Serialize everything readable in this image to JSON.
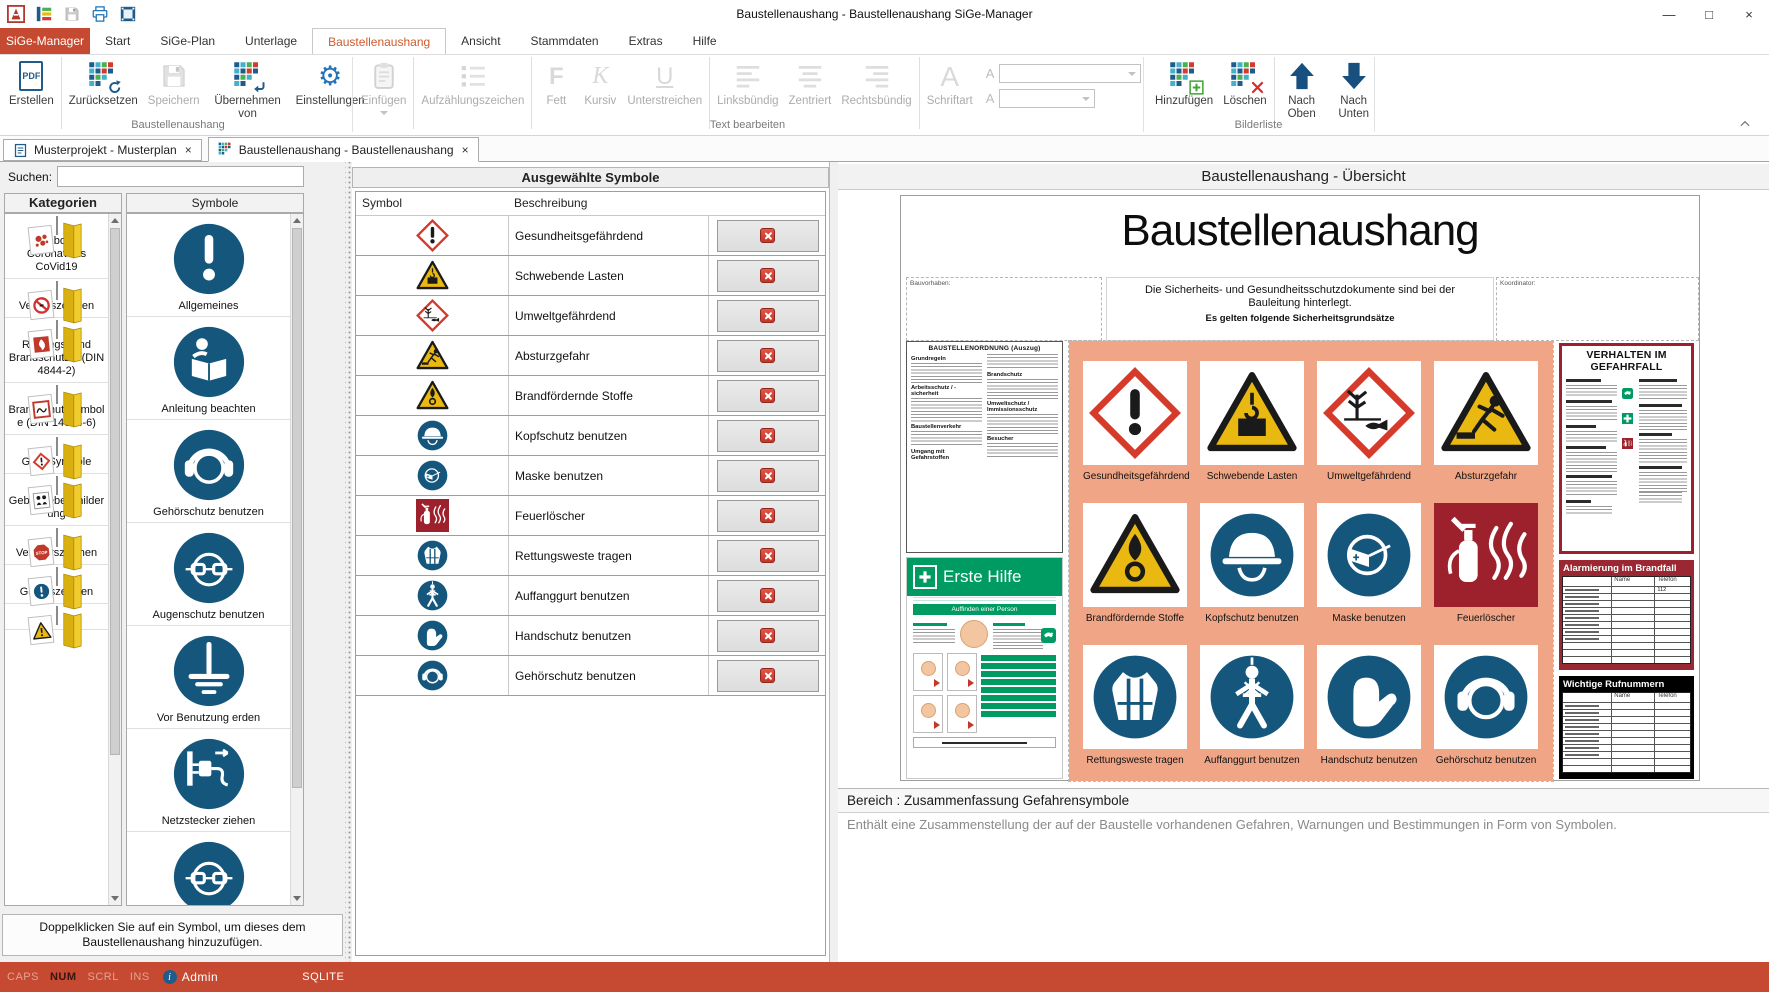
{
  "window": {
    "title": "Baustellenaushang - Baustellenaushang SiGe-Manager",
    "controls": {
      "minimize": "—",
      "maximize": "□",
      "close": "×"
    }
  },
  "menu": {
    "app_tab": "SiGe-Manager",
    "tabs": [
      "Start",
      "SiGe-Plan",
      "Unterlage",
      "Baustellenaushang",
      "Ansicht",
      "Stammdaten",
      "Extras",
      "Hilfe"
    ]
  },
  "ribbon": {
    "groups": [
      {
        "label": "Baustellenaushang"
      },
      {
        "label": "Text bearbeiten"
      },
      {
        "label": "Bilderliste"
      }
    ],
    "buttons": {
      "erstellen": "Erstellen",
      "zuruecksetzen": "Zurücksetzen",
      "speichern": "Speichern",
      "uebernehmen_von": "Übernehmen von",
      "einstellungen": "Einstellungen",
      "einfuegen": "Einfügen",
      "aufzaehlungszeichen": "Aufzählungszeichen",
      "fett": "Fett",
      "kursiv": "Kursiv",
      "unterstreichen": "Unterstreichen",
      "linksbuendig": "Linksbündig",
      "zentriert": "Zentriert",
      "rechtsbuendig": "Rechtsbündig",
      "schriftart": "Schriftart",
      "hinzufuegen": "Hinzufügen",
      "loeschen": "Löschen",
      "nach_oben": "Nach Oben",
      "nach_unten": "Nach Unten"
    },
    "glyphs": {
      "pdf": "PDF",
      "fett": "F",
      "kursiv": "K",
      "unterstreichen": "U",
      "schriftart": "A",
      "font_name": "A",
      "font_size": "A"
    }
  },
  "document_tabs": [
    "Musterprojekt - Musterplan",
    "Baustellenaushang - Baustellenaushang"
  ],
  "close_glyph": "×",
  "left_panel": {
    "search_label": "Suchen:",
    "search_value": "",
    "categories_header": "Kategorien",
    "symbols_header": "Symbole",
    "categories": [
      {
        "label": "Symbole - Coronavirus CoVid19",
        "icon": "folder-virus-icon"
      },
      {
        "label": "Verbotszeichen",
        "icon": "folder-prohibition-icon"
      },
      {
        "label": "Rettungs- und Brandschutzz. (DIN 4844-2)",
        "icon": "folder-fire-safety-icon"
      },
      {
        "label": "Brandschutzsymbole (DIN 14034-6)",
        "icon": "folder-din14034-icon"
      },
      {
        "label": "GHS Symbole",
        "icon": "folder-ghs-icon"
      },
      {
        "label": "Gebäudebeschilderung",
        "icon": "folder-building-signs-icon"
      },
      {
        "label": "Verkehrszeichen",
        "icon": "folder-stop-sign-icon",
        "badge_text": "STOP"
      },
      {
        "label": "Gebotszeichen",
        "icon": "folder-mandatory-icon"
      }
    ],
    "symbols": [
      {
        "label": "Allgemeines",
        "icon": "mandatory-general-icon"
      },
      {
        "label": "Anleitung beachten",
        "icon": "mandatory-read-manual-icon"
      },
      {
        "label": "Gehörschutz benutzen",
        "icon": "mandatory-ear-protection-icon"
      },
      {
        "label": "Augenschutz benutzen",
        "icon": "mandatory-eye-protection-icon"
      },
      {
        "label": "Vor Benutzung erden",
        "icon": "mandatory-ground-icon"
      },
      {
        "label": "Netzstecker ziehen",
        "icon": "mandatory-unplug-icon"
      }
    ],
    "hint": "Doppelklicken Sie auf ein Symbol, um dieses dem Baustellenaushang hinzuzufügen."
  },
  "selected_symbols": {
    "title": "Ausgewählte Symbole",
    "columns": {
      "symbol": "Symbol",
      "description": "Beschreibung"
    },
    "rows": [
      {
        "description": "Gesundheitsgefährdend",
        "icon": "ghs-health-hazard-icon"
      },
      {
        "description": "Schwebende Lasten",
        "icon": "warning-suspended-load-icon"
      },
      {
        "description": "Umweltgefährdend",
        "icon": "ghs-environment-icon"
      },
      {
        "description": "Absturzgefahr",
        "icon": "warning-fall-icon"
      },
      {
        "description": "Brandfördernde Stoffe",
        "icon": "warning-oxidizer-icon"
      },
      {
        "description": "Kopfschutz benutzen",
        "icon": "mandatory-helmet-icon"
      },
      {
        "description": "Maske benutzen",
        "icon": "mandatory-mask-icon"
      },
      {
        "description": "Feuerlöscher",
        "icon": "fire-extinguisher-icon"
      },
      {
        "description": "Rettungsweste tragen",
        "icon": "mandatory-life-vest-icon"
      },
      {
        "description": "Auffanggurt benutzen",
        "icon": "mandatory-harness-icon"
      },
      {
        "description": "Handschutz benutzen",
        "icon": "mandatory-gloves-icon"
      },
      {
        "description": "Gehörschutz benutzen",
        "icon": "mandatory-ear-protection-icon"
      }
    ]
  },
  "preview": {
    "header": "Baustellenaushang - Übersicht",
    "poster": {
      "title": "Baustellenaushang",
      "bauvorhaben_label": "Bauvorhaben:",
      "koordinator_label": "Koordinator:",
      "statement": "Die Sicherheits- und Gesundheitsschutzdokumente sind bei der Bauleitung hinterlegt.",
      "statement_bold": "Es gelten folgende Sicherheitsgrundsätze",
      "ordnung_title": "BAUSTELLENORDNUNG (Auszug)",
      "ordnung_sections": [
        "Grundregeln",
        "Arbeitsschutz / -sicherheit",
        "Baustellenverkehr",
        "Umgang mit Gefahrstoffen",
        "Brandschutz",
        "Umweltschutz / Immissionsschutz",
        "Besucher"
      ],
      "erste_hilfe_title": "Erste Hilfe",
      "erste_hilfe_subtitle": "Auffinden einer Person",
      "gefahrfall_title": "VERHALTEN IM GEFAHRFALL",
      "alarmierung_title": "Alarmierung im Brandfall",
      "rufnummern_title": "Wichtige Rufnummern",
      "table_columns": {
        "name": "Name",
        "telefon": "Telefon"
      },
      "notruf_nummer": "112"
    },
    "bereich_title": "Bereich : Zusammenfassung Gefahrensymbole",
    "bereich_description": "Enthält eine Zusammenstellung der auf der Baustelle vorhandenen Gefahren, Warnungen und Bestimmungen in Form von Symbolen."
  },
  "status_bar": {
    "caps": "CAPS",
    "num": "NUM",
    "scrl": "SCRL",
    "ins": "INS",
    "info_glyph": "i",
    "user": "Admin",
    "db": "SQLITE"
  },
  "colors": {
    "accent_orange": "#C64A31",
    "mandatory_blue": "#15567C",
    "warning_yellow": "#E9B912",
    "ghs_red": "#D63A2A",
    "fire_red": "#9C212C",
    "first_aid_green": "#009B63",
    "selection_salmon": "#F0A686",
    "ribbon_blue": "#1F5C8B"
  }
}
